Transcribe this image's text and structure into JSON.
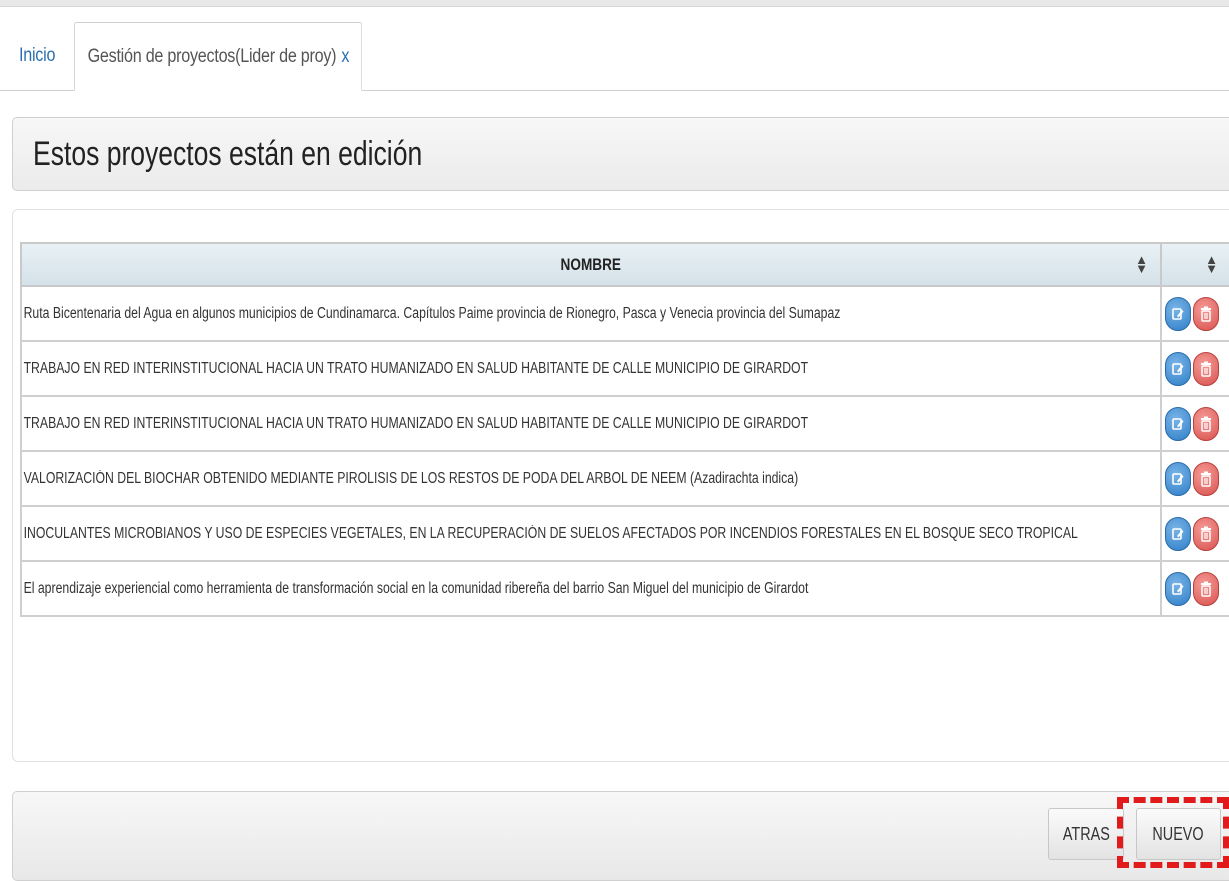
{
  "tabs": {
    "home_label": "Inicio",
    "active_label": "Gestión de proyectos(Lider de proy)",
    "active_close": "x"
  },
  "panel": {
    "title": "Estos proyectos están en edición"
  },
  "table": {
    "columns": [
      "NOMBRE",
      ""
    ],
    "rows": [
      {
        "nombre": "Ruta Bicentenaria del Agua en algunos municipios de Cundinamarca. Capítulos Paime provincia de Rionegro, Pasca y Venecia provincia del Sumapaz"
      },
      {
        "nombre": "TRABAJO EN RED INTERINSTITUCIONAL HACIA UN TRATO HUMANIZADO EN SALUD HABITANTE DE CALLE MUNICIPIO DE GIRARDOT"
      },
      {
        "nombre": "TRABAJO EN RED INTERINSTITUCIONAL HACIA UN TRATO HUMANIZADO EN SALUD HABITANTE DE CALLE MUNICIPIO DE GIRARDOT"
      },
      {
        "nombre": "VALORIZACIÓN DEL BIOCHAR OBTENIDO MEDIANTE PIROLISIS DE LOS RESTOS DE PODA DEL ARBOL DE NEEM (Azadirachta indica)"
      },
      {
        "nombre": "INOCULANTES MICROBIANOS Y USO DE ESPECIES VEGETALES, EN LA RECUPERACIÓN DE SUELOS AFECTADOS POR INCENDIOS FORESTALES EN EL BOSQUE SECO TROPICAL"
      },
      {
        "nombre": "El aprendizaje experiencial como herramienta de transformación social en la comunidad ribereña del barrio San Miguel del municipio de Girardot"
      }
    ],
    "row_actions": [
      "edit-icon",
      "trash-icon"
    ]
  },
  "footer": {
    "back_label": "ATRAS",
    "new_label": "NUEVO"
  },
  "colors": {
    "link": "#2a6fb0",
    "edit": "#2f7fc9",
    "delete": "#d9534f",
    "highlight": "#e11b1b",
    "header_bg": "#dbe7ed"
  }
}
